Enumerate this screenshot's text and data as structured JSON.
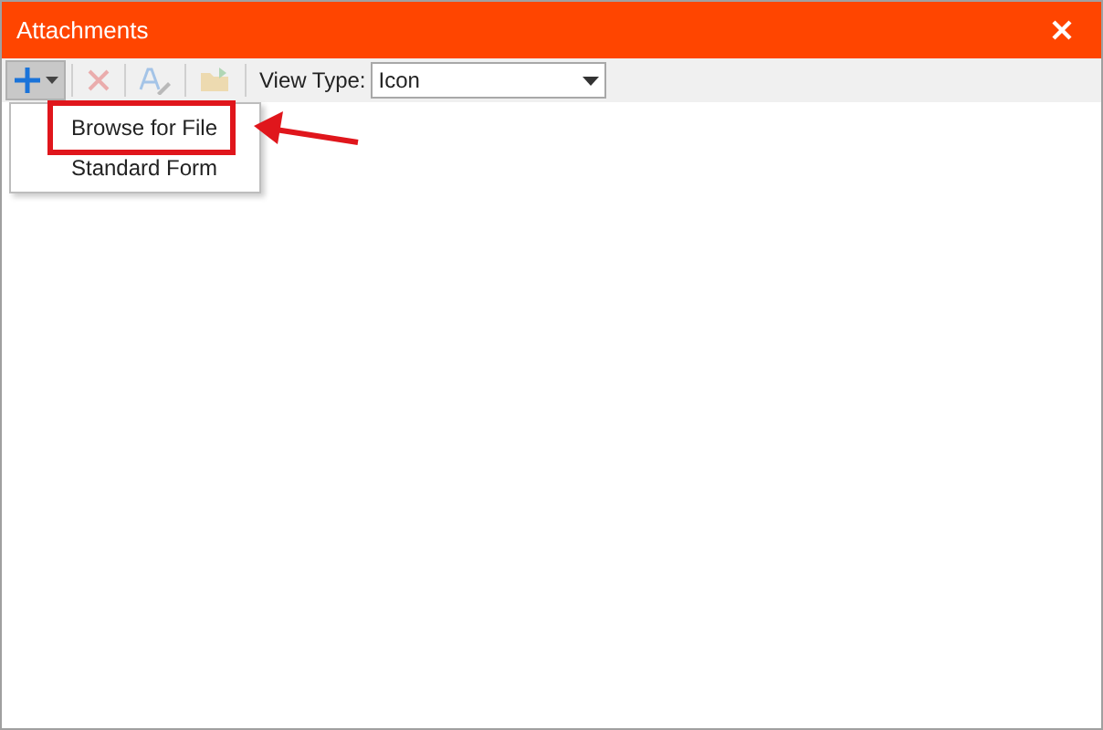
{
  "window": {
    "title": "Attachments"
  },
  "toolbar": [
    {
      "kind": "add",
      "pressed": true,
      "disabled": false
    },
    {
      "kind": "delete",
      "pressed": false,
      "disabled": true
    },
    {
      "kind": "rename",
      "pressed": false,
      "disabled": true
    },
    {
      "kind": "open",
      "pressed": false,
      "disabled": true
    }
  ],
  "view_type": {
    "label": "View Type:",
    "value": "Icon"
  },
  "menu": [
    {
      "label": "Browse for File",
      "marked": true
    },
    {
      "label": "Standard Form",
      "marked": false
    }
  ]
}
